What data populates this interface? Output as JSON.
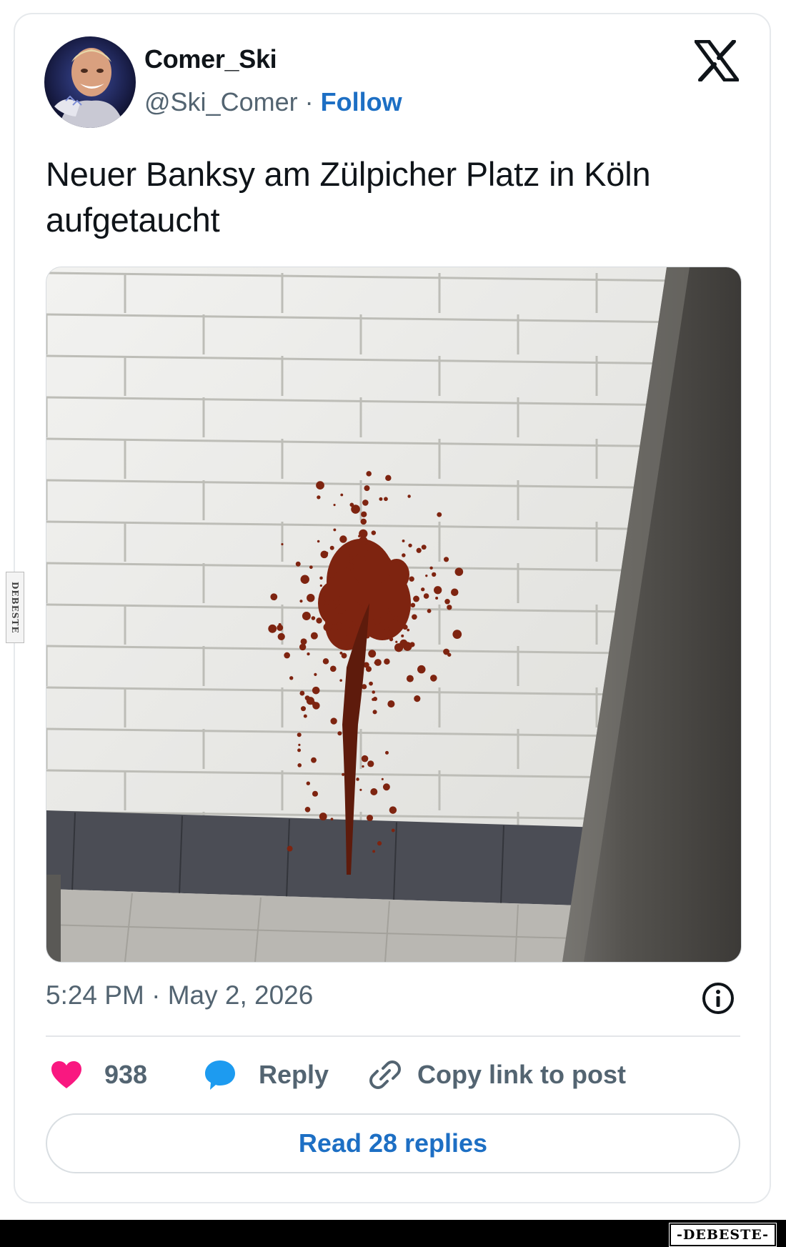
{
  "post": {
    "author_name": "Comer_Ski",
    "handle": "@Ski_Comer",
    "separator": "·",
    "follow_label": "Follow",
    "text": "Neuer Banksy am Zülpicher Platz in Köln aufgetaucht",
    "time": "5:24 PM",
    "date": "May 2, 2026",
    "platform_logo": "x-logo-icon"
  },
  "actions": {
    "likes_count": "938",
    "reply_label": "Reply",
    "copy_link_label": "Copy link to post",
    "read_replies_label": "Read 28 replies"
  },
  "colors": {
    "like": "#f91880",
    "reply": "#1d9bf0",
    "link": "#1d6fc4",
    "muted": "#536471"
  },
  "watermark": {
    "side": "DEBESTE",
    "bottom": "-DEBESTE-"
  }
}
